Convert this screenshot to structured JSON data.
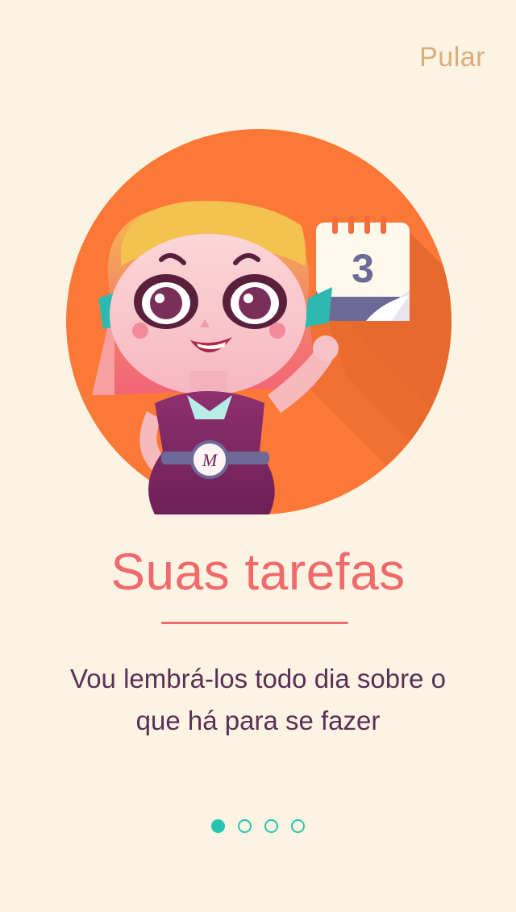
{
  "header": {
    "skip_label": "Pular"
  },
  "illustration": {
    "calendar_day": "3",
    "badge_letter": "M"
  },
  "content": {
    "title": "Suas tarefas",
    "description_line1": "Vou lembrá-los todo dia sobre o",
    "description_line2": "que há para se fazer"
  },
  "pager": {
    "total": 4,
    "active_index": 0
  },
  "colors": {
    "background": "#fdf3e3",
    "circle": "#fc7837",
    "title": "#f06a6c",
    "text": "#5a2f57",
    "skip": "#d9ad7c",
    "dot": "#26c4b4"
  }
}
